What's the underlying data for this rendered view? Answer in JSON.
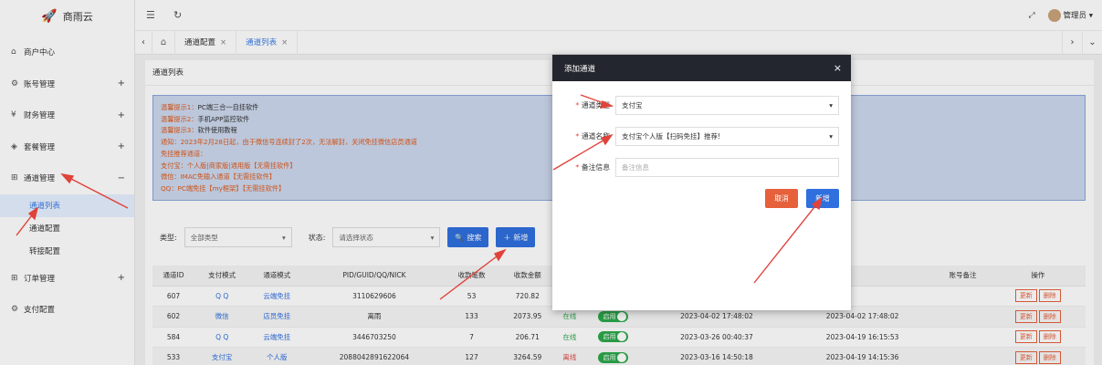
{
  "app": {
    "name": "商雨云",
    "user": "管理员"
  },
  "sidebar": {
    "items": [
      {
        "icon": "home-icon",
        "glyph": "⌂",
        "label": "商户中心",
        "expand": ""
      },
      {
        "icon": "gear-icon",
        "glyph": "⚙",
        "label": "账号管理",
        "expand": "+"
      },
      {
        "icon": "money-icon",
        "glyph": "¥",
        "label": "财务管理",
        "expand": "+"
      },
      {
        "icon": "package-icon",
        "glyph": "◈",
        "label": "套餐管理",
        "expand": "+"
      },
      {
        "icon": "channel-icon",
        "glyph": "⊞",
        "label": "通道管理",
        "expand": "−"
      }
    ],
    "sub_items": [
      {
        "label": "通道列表",
        "active": true
      },
      {
        "label": "通道配置",
        "active": false
      },
      {
        "label": "转接配置",
        "active": false
      }
    ],
    "items2": [
      {
        "icon": "order-icon",
        "glyph": "⊞",
        "label": "订单管理",
        "expand": "+"
      },
      {
        "icon": "payment-icon",
        "glyph": "⚙",
        "label": "支付配置",
        "expand": ""
      }
    ]
  },
  "tabs": [
    {
      "label": "通道配置",
      "close": "×"
    },
    {
      "label": "通道列表",
      "close": "×"
    }
  ],
  "panel": {
    "title": "通道列表"
  },
  "notice": [
    {
      "k": "温馨提示1：",
      "v": "PC端三合一自挂软件"
    },
    {
      "k": "温馨提示2：",
      "v": "手机APP监控软件"
    },
    {
      "k": "温馨提示3：",
      "v": "软件使用教程"
    },
    {
      "k": "通知：2023年2月28日起，由于微信号连续封了2次，无法解封，关闭免挂微信店员通道",
      "v": ""
    },
    {
      "k": "免挂推荐通道：",
      "v": ""
    },
    {
      "k": "支付宝：个人版|商家版|通用版【无需挂软件】",
      "v": ""
    },
    {
      "k": "微信：IMAC免输入通道【无需挂软件】",
      "v": ""
    },
    {
      "k": "QQ：PC端免挂【my框架】【无需挂软件】",
      "v": ""
    }
  ],
  "filter": {
    "type_label": "类型:",
    "type_value": "全部类型",
    "status_label": "状态:",
    "status_value": "请选择状态",
    "search": "搜索",
    "add": "新增"
  },
  "table": {
    "headers": [
      "通道ID",
      "支付模式",
      "通道模式",
      "PID/GUID/QQ/NICK",
      "收款笔数",
      "收款金额",
      "",
      "",
      "",
      "",
      "账号备注",
      "操作"
    ],
    "rows": [
      {
        "id": "607",
        "pay": "Q Q",
        "mode": "云端免挂",
        "pid": "3110629606",
        "count": "53",
        "amount": "720.82",
        "state": "",
        "toggle": "",
        "t1": "",
        "t2": "",
        "note": ""
      },
      {
        "id": "602",
        "pay": "微信",
        "mode": "店员免挂",
        "pid": "离雨",
        "count": "133",
        "amount": "2073.95",
        "state": "在线",
        "toggle": "启用",
        "t1": "2023-04-02 17:48:02",
        "t2": "2023-04-02 17:48:02",
        "note": ""
      },
      {
        "id": "584",
        "pay": "Q Q",
        "mode": "云端免挂",
        "pid": "3446703250",
        "count": "7",
        "amount": "206.71",
        "state": "在线",
        "toggle": "启用",
        "t1": "2023-03-26 00:40:37",
        "t2": "2023-04-19 16:15:53",
        "note": ""
      },
      {
        "id": "533",
        "pay": "支付宝",
        "mode": "个人版",
        "pid": "2088042891622064",
        "count": "127",
        "amount": "3264.59",
        "state": "离线",
        "toggle": "启用",
        "t1": "2023-03-16 14:50:18",
        "t2": "2023-04-19 14:15:36",
        "note": ""
      }
    ],
    "actions": [
      "更新",
      "删除"
    ]
  },
  "modal": {
    "title": "添加通道",
    "fields": [
      {
        "label": "通道类型",
        "required": true,
        "value": "支付宝",
        "placeholder": "",
        "select": true
      },
      {
        "label": "通道名称",
        "required": true,
        "value": "支付宝个人版【扫码免挂】推荐!",
        "placeholder": "",
        "select": true
      },
      {
        "label": "备注信息",
        "required": true,
        "value": "",
        "placeholder": "备注信息",
        "select": false
      }
    ],
    "cancel": "取消",
    "confirm": "新增"
  },
  "colors": {
    "accent": "#2f6fde",
    "modal_header": "#23262e",
    "cancel": "#e6603b",
    "annotation": "#e0433a"
  }
}
